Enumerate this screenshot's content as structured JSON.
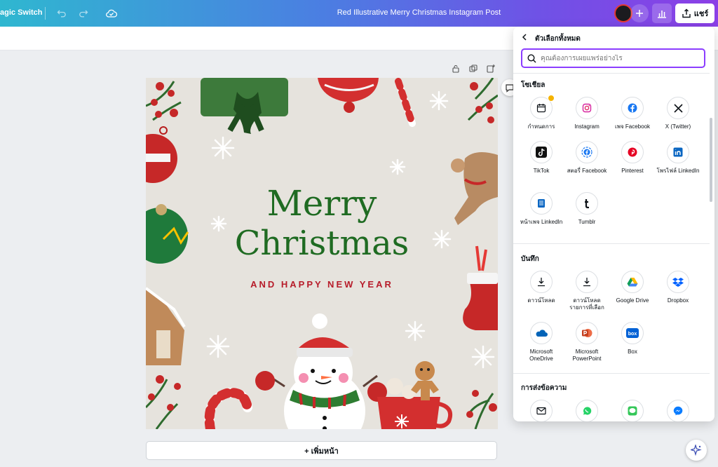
{
  "topbar": {
    "magic_switch_label": "agic Switch",
    "document_title": "Red Illustrative Merry Christmas Instagram Post",
    "share_label": "แชร์",
    "colors": {
      "gradient_start": "#2fb7d0",
      "gradient_end": "#8b3fe6"
    }
  },
  "design": {
    "headline_1": "Merry",
    "headline_2": "Christmas",
    "subline": "AND HAPPY NEW YEAR"
  },
  "canvas": {
    "add_page_label": "+ เพิ่มหน้า"
  },
  "share_panel": {
    "title": "ตัวเลือกทั้งหมด",
    "search_placeholder": "คุณต้องการเผยแพร่อย่างไร",
    "social": {
      "title": "โซเชียล",
      "items": [
        {
          "label": "กำหนดการ",
          "icon": "calendar-icon"
        },
        {
          "label": "Instagram",
          "icon": "instagram-icon"
        },
        {
          "label": "เพจ Facebook",
          "icon": "facebook-icon"
        },
        {
          "label": "X (Twitter)",
          "icon": "x-twitter-icon"
        },
        {
          "label": "TikTok",
          "icon": "tiktok-icon"
        },
        {
          "label": "สตอรี่ Facebook",
          "icon": "facebook-story-icon"
        },
        {
          "label": "Pinterest",
          "icon": "pinterest-icon"
        },
        {
          "label": "โพรไฟล์ LinkedIn",
          "icon": "linkedin-icon"
        },
        {
          "label": "หน้าเพจ LinkedIn",
          "icon": "linkedin-page-icon"
        },
        {
          "label": "Tumblr",
          "icon": "tumblr-icon"
        }
      ]
    },
    "save": {
      "title": "บันทึก",
      "items": [
        {
          "label": "ดาวน์โหลด",
          "icon": "download-icon"
        },
        {
          "label": "ดาวน์โหลดรายการที่เลือก",
          "icon": "download-selected-icon"
        },
        {
          "label": "Google Drive",
          "icon": "google-drive-icon"
        },
        {
          "label": "Dropbox",
          "icon": "dropbox-icon"
        },
        {
          "label": "Microsoft OneDrive",
          "icon": "onedrive-icon"
        },
        {
          "label": "Microsoft PowerPoint",
          "icon": "powerpoint-icon"
        },
        {
          "label": "Box",
          "icon": "box-icon"
        }
      ]
    },
    "messaging": {
      "title": "การส่งข้อความ",
      "items": [
        {
          "label": "",
          "icon": "email-icon"
        },
        {
          "label": "",
          "icon": "whatsapp-icon"
        },
        {
          "label": "",
          "icon": "imessage-icon"
        },
        {
          "label": "",
          "icon": "messenger-icon"
        }
      ]
    },
    "colors": {
      "accent": "#8b3dff"
    }
  }
}
